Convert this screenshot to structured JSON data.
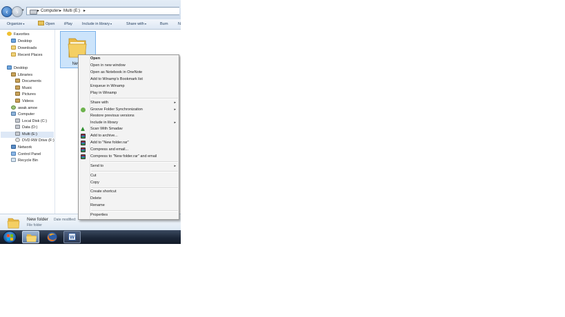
{
  "address": {
    "breadcrumb": [
      {
        "separator": "▸",
        "label": "Computer"
      },
      {
        "separator": "▸",
        "label": "Multi (E:)"
      },
      {
        "separator": "▸",
        "label": ""
      }
    ]
  },
  "toolbar": {
    "items": [
      {
        "label": "Organize",
        "dropdown": true
      },
      {
        "label": "Open",
        "dropdown": false
      },
      {
        "label": "iPlay",
        "dropdown": false
      },
      {
        "label": "Include in library",
        "dropdown": true
      },
      {
        "label": "Share with",
        "dropdown": true
      },
      {
        "label": "Burn",
        "dropdown": false
      },
      {
        "label": "N",
        "dropdown": false
      }
    ]
  },
  "navpane": {
    "items": [
      {
        "label": "Favorites",
        "icon": "favorites-icon"
      },
      {
        "label": "Desktop",
        "icon": "desktop-icon"
      },
      {
        "label": "Downloads",
        "icon": "downloads-icon"
      },
      {
        "label": "Recent Places",
        "icon": "recent-places-icon"
      },
      {
        "label": "Desktop",
        "icon": "desktop-icon"
      },
      {
        "label": "Libraries",
        "icon": "libraries-icon"
      },
      {
        "label": "Documents",
        "icon": "documents-icon"
      },
      {
        "label": "Music",
        "icon": "music-icon"
      },
      {
        "label": "Pictures",
        "icon": "pictures-icon"
      },
      {
        "label": "Videos",
        "icon": "videos-icon"
      },
      {
        "label": "awak amoe",
        "icon": "user-icon"
      },
      {
        "label": "Computer",
        "icon": "computer-icon"
      },
      {
        "label": "Local Disk (C:)",
        "icon": "drive-icon"
      },
      {
        "label": "Data (D:)",
        "icon": "drive-icon"
      },
      {
        "label": "Multi (E:)",
        "icon": "drive-icon"
      },
      {
        "label": "DVD RW Drive (F:)",
        "icon": "dvd-icon"
      },
      {
        "label": "Network",
        "icon": "network-icon"
      },
      {
        "label": "Control Panel",
        "icon": "control-panel-icon"
      },
      {
        "label": "Recycle Bin",
        "icon": "recycle-bin-icon"
      }
    ]
  },
  "content": {
    "folder_label": "New fo"
  },
  "context_menu": {
    "items": [
      {
        "label": "Open",
        "bold": true
      },
      {
        "label": "Open in new window"
      },
      {
        "label": "Open as Notebook in OneNote"
      },
      {
        "label": "Add to Winamp's Bookmark list"
      },
      {
        "label": "Enqueue in Winamp"
      },
      {
        "label": "Play in Winamp"
      },
      {
        "label": "Share with",
        "submenu": true
      },
      {
        "label": "Groove Folder Synchronization",
        "submenu": true,
        "icon": "groove-icon"
      },
      {
        "label": "Restore previous versions"
      },
      {
        "label": "Include in library",
        "submenu": true
      },
      {
        "label": "Scan With Smadav",
        "icon": "smadav-icon"
      },
      {
        "label": "Add to archive...",
        "icon": "winrar-icon"
      },
      {
        "label": "Add to \"New folder.rar\"",
        "icon": "winrar-icon"
      },
      {
        "label": "Compress and email...",
        "icon": "winrar-icon"
      },
      {
        "label": "Compress to \"New folder.rar\" and email",
        "icon": "winrar-icon"
      },
      {
        "label": "Send to",
        "submenu": true
      },
      {
        "label": "Cut"
      },
      {
        "label": "Copy"
      },
      {
        "label": "Create shortcut"
      },
      {
        "label": "Delete"
      },
      {
        "label": "Rename"
      },
      {
        "label": "Properties"
      }
    ],
    "submenu_glyph": "▸"
  },
  "details": {
    "name": "New folder",
    "modified_label": "Date modified:",
    "modified_value": "",
    "type": "File folder"
  },
  "taskbar": {
    "apps": [
      "start-orb-icon",
      "windows-explorer-icon",
      "firefox-icon",
      "word-icon"
    ]
  },
  "colors": {
    "selection": "#cce4fb",
    "taskbar": "#1c2738",
    "menu_bg": "#f3f3f3"
  }
}
